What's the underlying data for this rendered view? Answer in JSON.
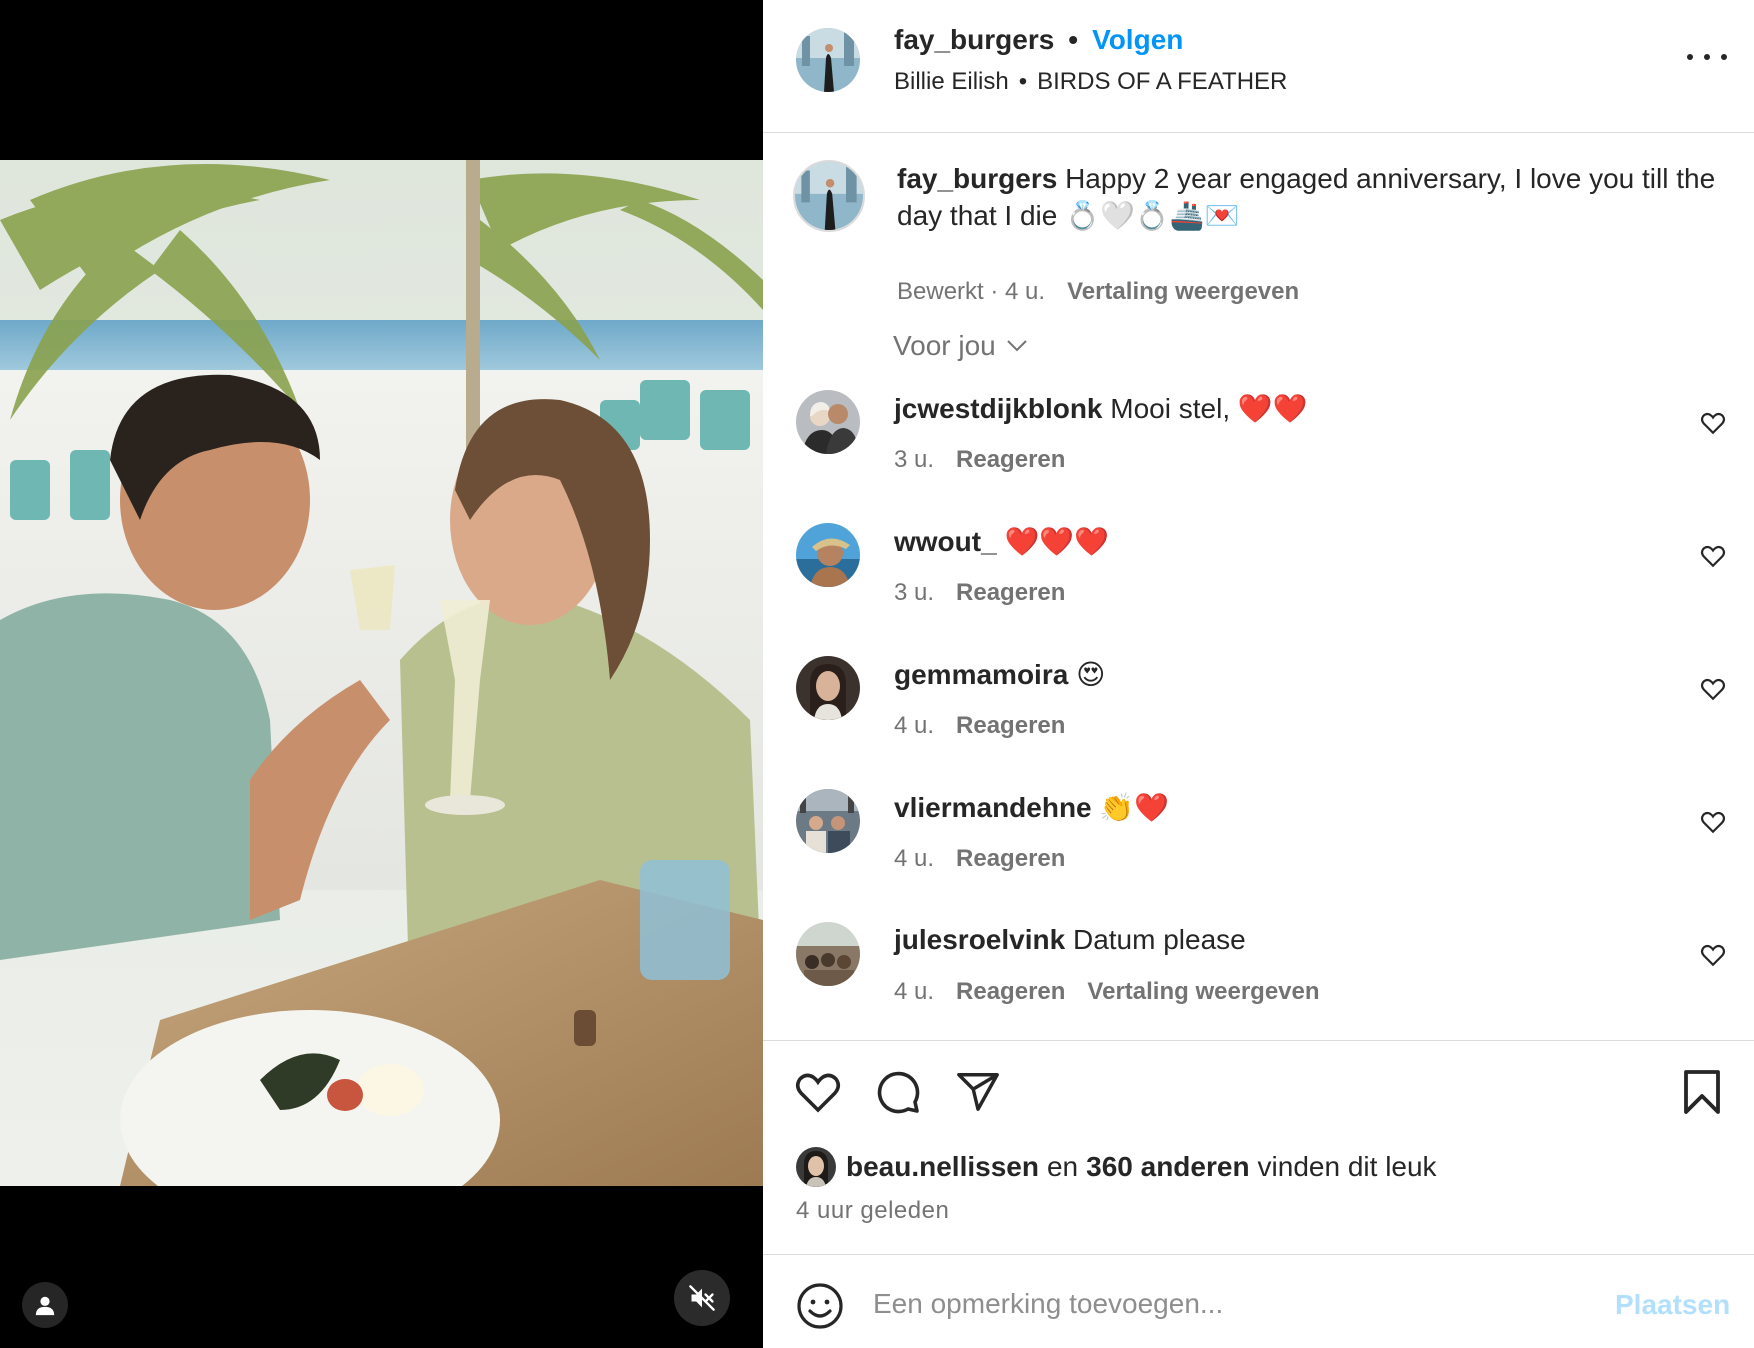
{
  "post": {
    "username": "fay_burgers",
    "follow_label": "Volgen",
    "separator": "•",
    "music_artist": "Billie Eilish",
    "music_title": "BIRDS OF A FEATHER"
  },
  "caption": {
    "username": "fay_burgers",
    "text": "Happy 2 year engaged anniversary, I love you till the day that I die 💍🤍💍🚢💌",
    "meta": "Bewerkt · 4 u.",
    "translate_label": "Vertaling weergeven"
  },
  "for_you_label": "Voor jou",
  "comments": [
    {
      "username": "jcwestdijkblonk",
      "text": "Mooi stel, ❤️❤️",
      "time": "3 u.",
      "reply_label": "Reageren",
      "translate_label": ""
    },
    {
      "username": "wwout_",
      "text": "❤️❤️❤️",
      "time": "3 u.",
      "reply_label": "Reageren",
      "translate_label": ""
    },
    {
      "username": "gemmamoira",
      "text": "😍",
      "time": "4 u.",
      "reply_label": "Reageren",
      "translate_label": ""
    },
    {
      "username": "vliermandehne",
      "text": "👏❤️",
      "time": "4 u.",
      "reply_label": "Reageren",
      "translate_label": ""
    },
    {
      "username": "julesroelvink",
      "text": "Datum please",
      "time": "4 u.",
      "reply_label": "Reageren",
      "translate_label": "Vertaling weergeven"
    }
  ],
  "likes": {
    "liker": "beau.nellissen",
    "connector": "en",
    "others": "360 anderen",
    "suffix": "vinden dit leuk"
  },
  "time_ago": "4 uur geleden",
  "add_comment": {
    "placeholder": "Een opmerking toevoegen...",
    "post_label": "Plaatsen"
  },
  "colors": {
    "link_blue": "#0095f6",
    "post_disabled": "#b2dffc",
    "secondary_text": "#737373",
    "divider": "#dbdbdb"
  },
  "icons": [
    "more-options-icon",
    "chevron-down-icon",
    "heart-icon",
    "comment-icon",
    "share-icon",
    "bookmark-icon",
    "emoji-icon",
    "user-tag-icon",
    "muted-icon"
  ]
}
